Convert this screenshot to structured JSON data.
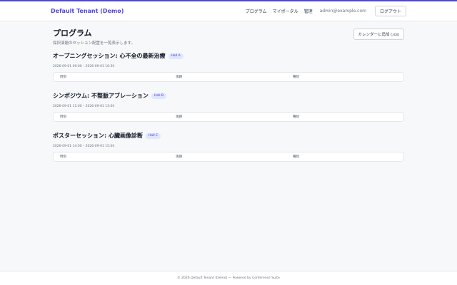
{
  "header": {
    "brand": "Default Tenant (Demo)",
    "nav": [
      "プログラム",
      "マイポータル",
      "管理"
    ],
    "email": "admin@example.com",
    "logout_label": "ログアウト"
  },
  "main": {
    "title": "プログラム",
    "subtitle": "採択演題のセッション配置を一覧表示します。",
    "ical_label": "カレンダーに追加 (.ics)",
    "table_headers": [
      "時刻",
      "演題",
      "種別"
    ],
    "sessions": [
      {
        "title": "オープニングセッション: 心不全の最新治療",
        "hall": "Hall A",
        "time": "2026-09-01 09:00 – 2026-09-01 10:30"
      },
      {
        "title": "シンポジウム: 不整脈アブレーション",
        "hall": "Hall B",
        "time": "2026-09-01 11:00 – 2026-09-01 13:00"
      },
      {
        "title": "ポスターセッション: 心臓画像診断",
        "hall": "Hall C",
        "time": "2026-09-01 14:00 – 2026-09-01 15:00"
      }
    ]
  },
  "footer": {
    "text": "© 2026 Default Tenant (Demo) — Powered by Conference Suite"
  }
}
